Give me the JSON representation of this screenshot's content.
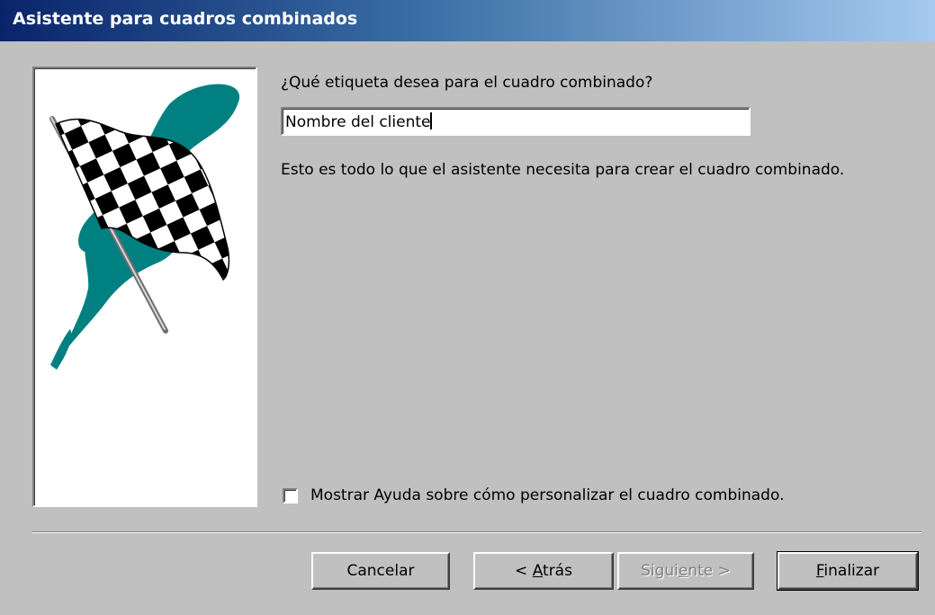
{
  "window": {
    "title": "Asistente para cuadros combinados"
  },
  "colors": {
    "face": "#c0c0c0",
    "title_gradient_start": "#0a246a",
    "title_gradient_end": "#a6caf0",
    "flag_splash": "#008080"
  },
  "illustration": {
    "icon": "checkered-flag-icon"
  },
  "prompt": {
    "label": "¿Qué etiqueta desea para el cuadro combinado?",
    "value": "Nombre del cliente"
  },
  "info": {
    "text": "Esto es todo lo que el asistente necesita para crear el cuadro combinado."
  },
  "help_option": {
    "label": "Mostrar Ayuda sobre cómo personalizar el cuadro combinado.",
    "checked": false
  },
  "buttons": {
    "cancel": "Cancelar",
    "back_prefix": "< ",
    "back_accel": "A",
    "back_rest": "trás",
    "next_prefix": "Sigui",
    "next_accel": "e",
    "next_rest": "nte >",
    "finish_accel": "F",
    "finish_rest": "inalizar"
  }
}
